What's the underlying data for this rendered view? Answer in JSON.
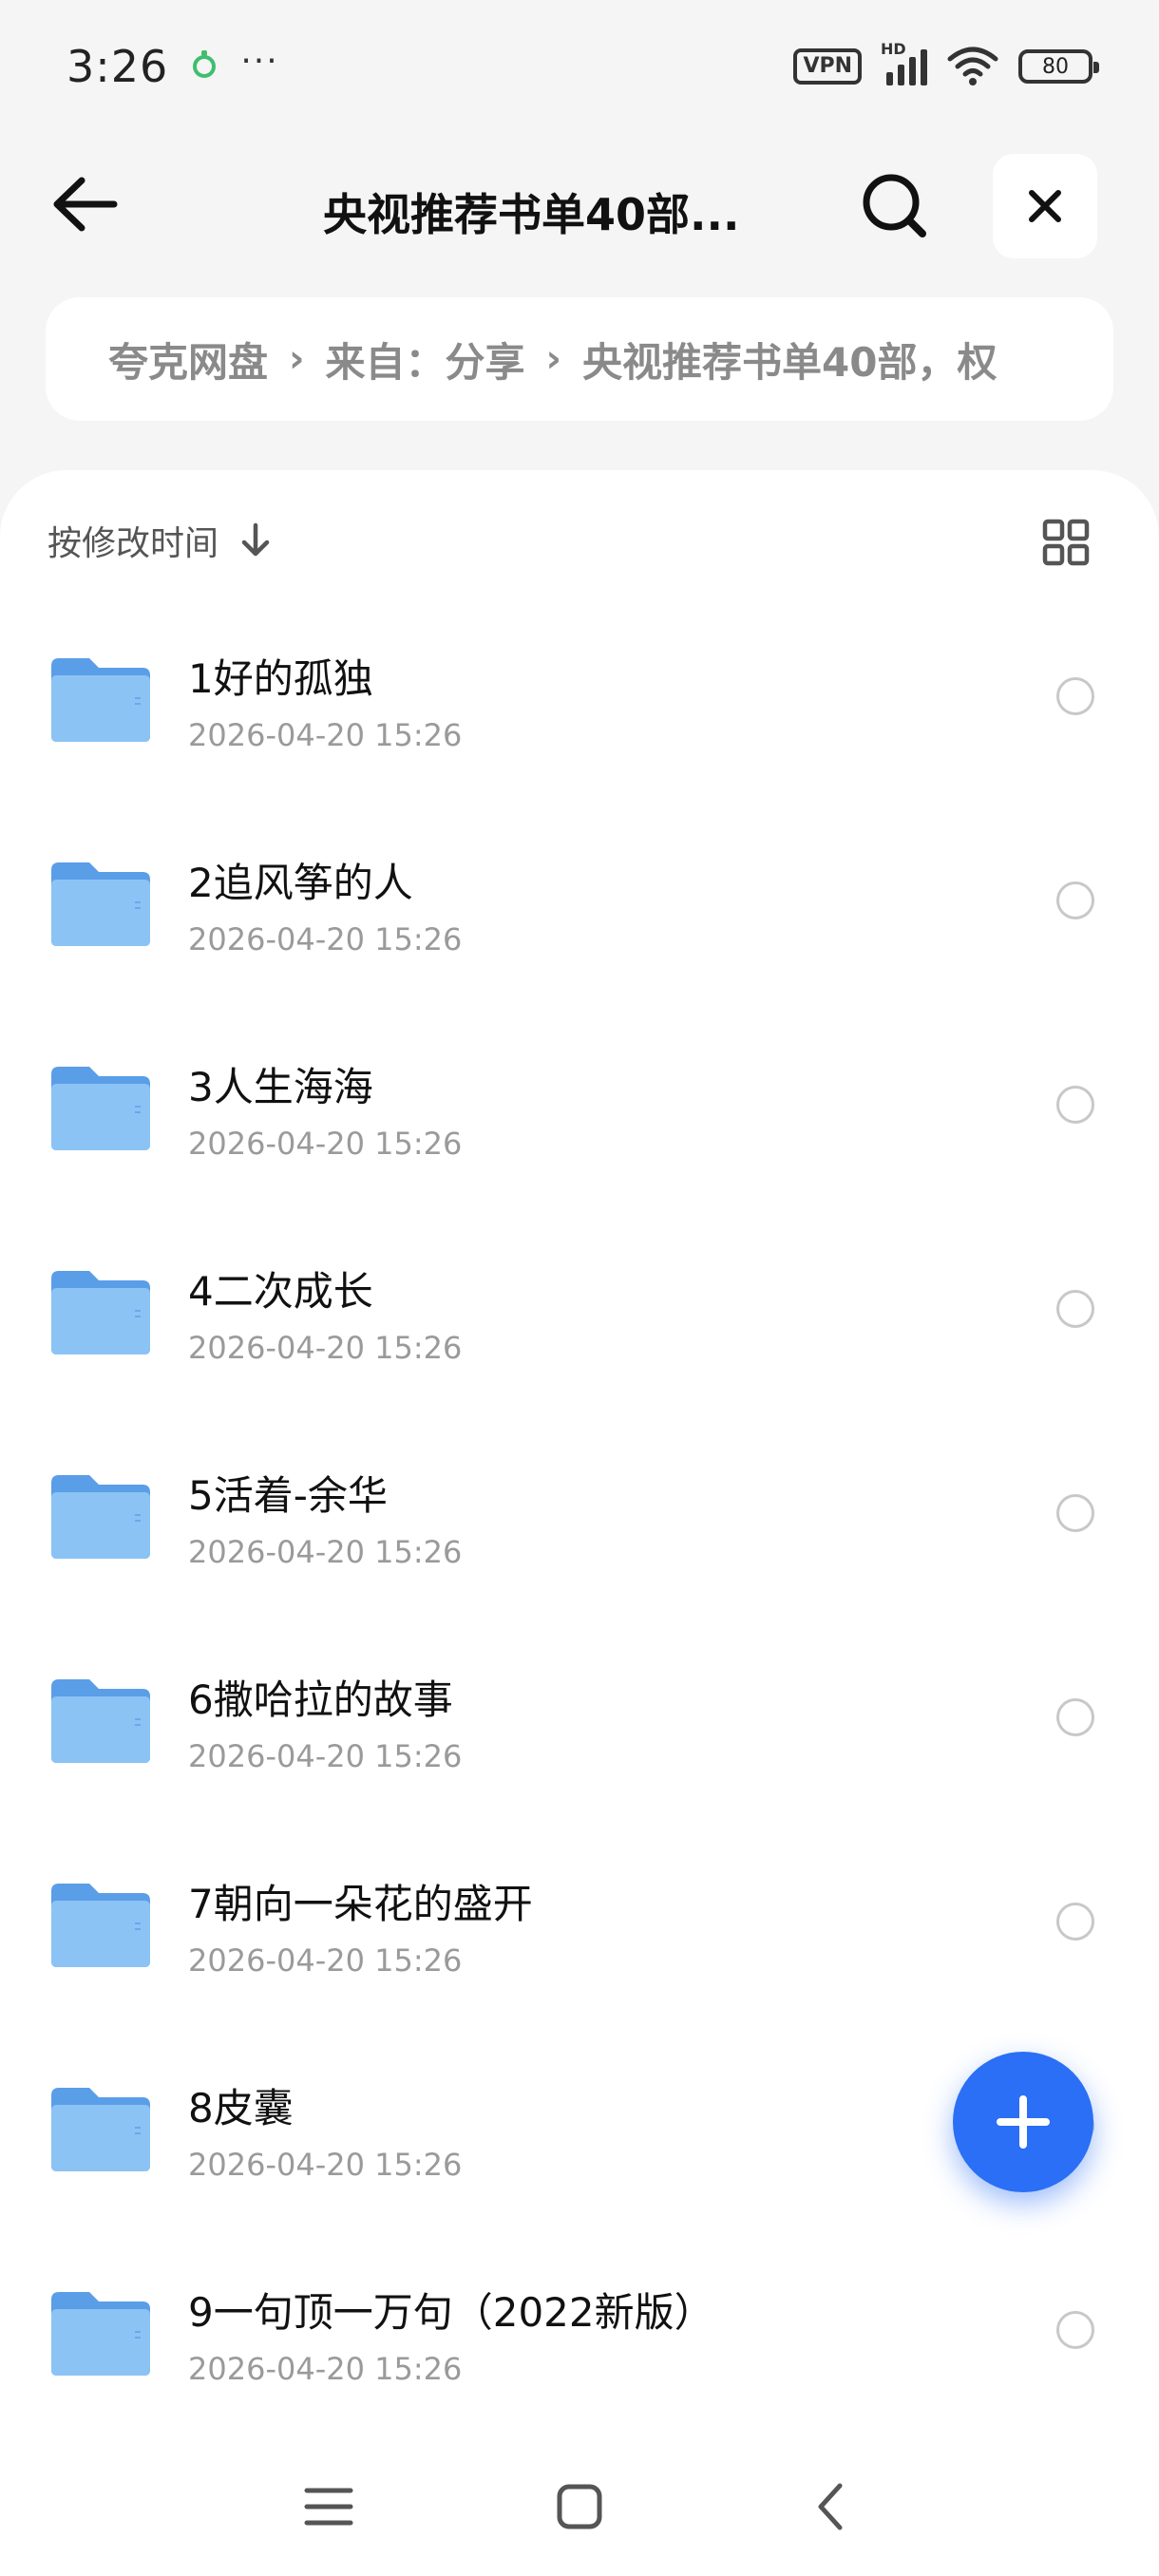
{
  "status_bar": {
    "time": "3:26",
    "dots": "···",
    "vpn": "VPN",
    "network": "HD",
    "battery": "80"
  },
  "header": {
    "title": "央视推荐书单40部...",
    "icons": {
      "back": "arrow-left-icon",
      "search": "search-icon",
      "close": "close-icon"
    }
  },
  "breadcrumb": {
    "items": [
      "夸克网盘",
      "来自：分享",
      "央视推荐书单40部，权"
    ],
    "separator": "›"
  },
  "sort": {
    "label": "按修改时间",
    "icon": "arrow-down-icon"
  },
  "files": [
    {
      "name": "1好的孤独",
      "date": "2026-04-20 15:26"
    },
    {
      "name": "2追风筝的人",
      "date": "2026-04-20 15:26"
    },
    {
      "name": "3人生海海",
      "date": "2026-04-20 15:26"
    },
    {
      "name": "4二次成长",
      "date": "2026-04-20 15:26"
    },
    {
      "name": "5活着-余华",
      "date": "2026-04-20 15:26"
    },
    {
      "name": "6撒哈拉的故事",
      "date": "2026-04-20 15:26"
    },
    {
      "name": "7朝向一朵花的盛开",
      "date": "2026-04-20 15:26"
    },
    {
      "name": "8皮囊",
      "date": "2026-04-20 15:26"
    },
    {
      "name": "9一句顶一万句（2022新版）",
      "date": "2026-04-20 15:26"
    }
  ],
  "fab": {
    "icon": "plus-icon",
    "color": "#2a6ff5"
  },
  "colors": {
    "folder": "#6fb0f2",
    "accent": "#2a6ff5"
  }
}
